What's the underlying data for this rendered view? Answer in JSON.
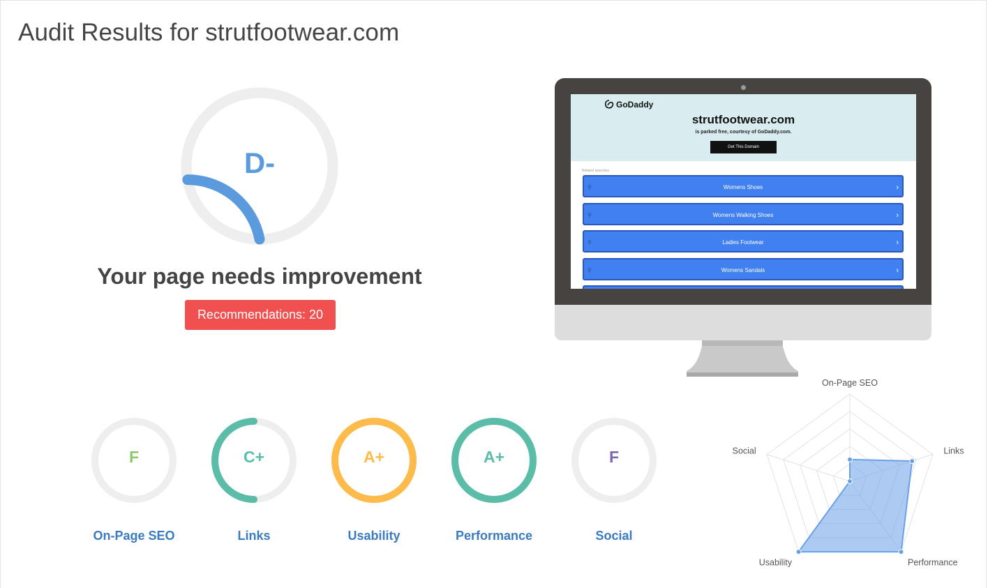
{
  "page": {
    "title": "Audit Results for strutfootwear.com"
  },
  "overall": {
    "grade": "D-",
    "score_fraction": 0.22,
    "headline": "Your page needs improvement",
    "recommendations_label": "Recommendations: 20"
  },
  "preview": {
    "logo": "GoDaddy",
    "domain": "strutfootwear.com",
    "subtitle": "is parked free, courtesy of GoDaddy.com.",
    "cta": "Get This Domain",
    "related_label": "Related searches",
    "searches": [
      "Womens Shoes",
      "Womens Walking Shoes",
      "Ladies Footwear",
      "Womens Sandals"
    ]
  },
  "categories": [
    {
      "name": "On-Page SEO",
      "grade": "F",
      "color": "#8cc96b",
      "fill": 0.0
    },
    {
      "name": "Links",
      "grade": "C+",
      "color": "#5bbda8",
      "fill": 0.5
    },
    {
      "name": "Usability",
      "grade": "A+",
      "color": "#fdbb4b",
      "fill": 1.0
    },
    {
      "name": "Performance",
      "grade": "A+",
      "color": "#5bbda8",
      "fill": 1.0
    },
    {
      "name": "Social",
      "grade": "F",
      "color": "#7b68b0",
      "fill": 0.0
    }
  ],
  "chart_data": {
    "type": "radar",
    "axes": [
      "On-Page SEO",
      "Links",
      "Performance",
      "Usability",
      "Social"
    ],
    "values": [
      0.25,
      0.75,
      1.0,
      1.0,
      0.0
    ],
    "range": [
      0,
      1
    ],
    "color": "#6aa0e8"
  }
}
